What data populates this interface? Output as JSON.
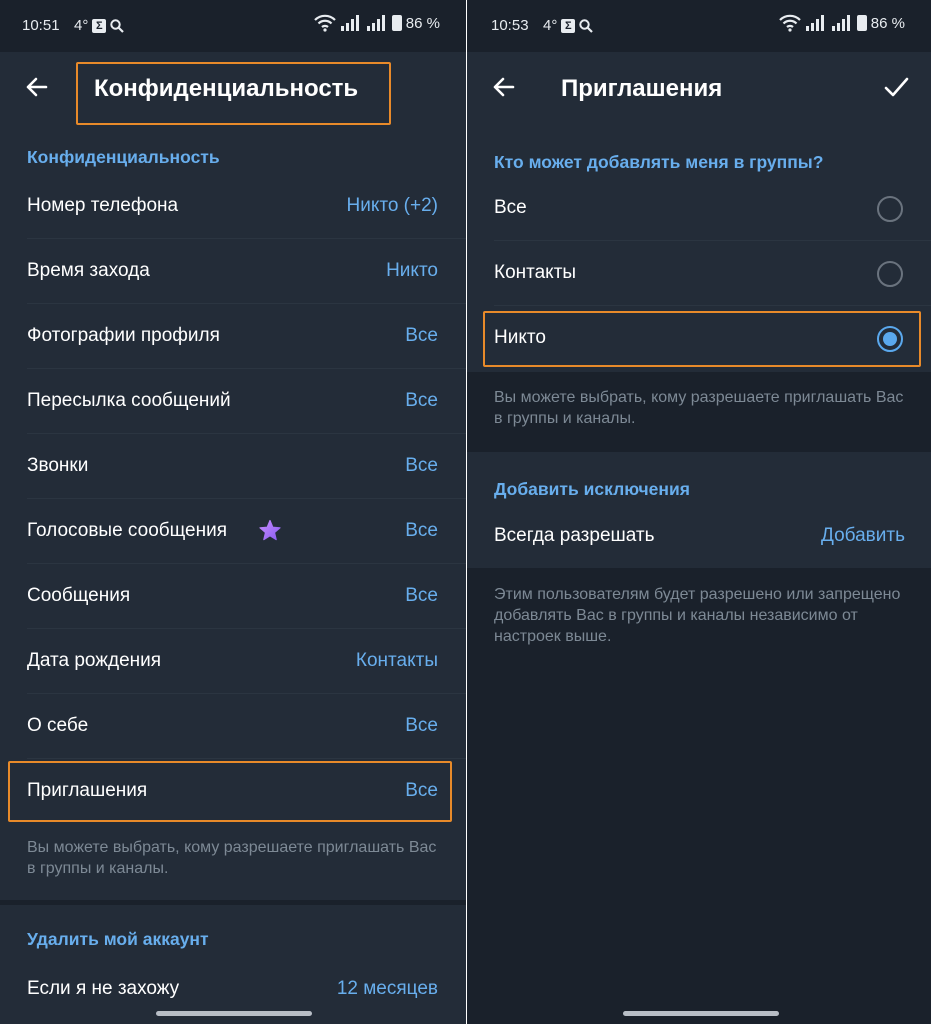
{
  "colors": {
    "background": "#1a212b",
    "section": "#232c38",
    "accent": "#68aeed",
    "note": "#7d8995",
    "highlight": "#e88a2a"
  },
  "left": {
    "status": {
      "time": "10:51",
      "temp": "4°",
      "battery": "86 %"
    },
    "title": "Конфиденциальность",
    "privacy_header": "Конфиденциальность",
    "items": [
      {
        "label": "Номер телефона",
        "value": "Никто (+2)"
      },
      {
        "label": "Время захода",
        "value": "Никто"
      },
      {
        "label": "Фотографии профиля",
        "value": "Все"
      },
      {
        "label": "Пересылка сообщений",
        "value": "Все"
      },
      {
        "label": "Звонки",
        "value": "Все"
      },
      {
        "label": "Голосовые сообщения",
        "value": "Все",
        "icon": "premium-star-icon"
      },
      {
        "label": "Сообщения",
        "value": "Все"
      },
      {
        "label": "Дата рождения",
        "value": "Контакты"
      },
      {
        "label": "О себе",
        "value": "Все"
      },
      {
        "label": "Приглашения",
        "value": "Все"
      }
    ],
    "note": "Вы можете выбрать, кому разрешаете приглашать Вас в группы и каналы.",
    "delete_header": "Удалить мой аккаунт",
    "delete_row": {
      "label": "Если я не захожу",
      "value": "12 месяцев"
    }
  },
  "right": {
    "status": {
      "time": "10:53",
      "temp": "4°",
      "battery": "86 %"
    },
    "title": "Приглашения",
    "who_header": "Кто может добавлять меня в группы?",
    "options": [
      {
        "label": "Все",
        "selected": false
      },
      {
        "label": "Контакты",
        "selected": false
      },
      {
        "label": "Никто",
        "selected": true
      }
    ],
    "note": "Вы можете выбрать, кому разрешаете приглашать Вас в группы и каналы.",
    "exceptions_header": "Добавить исключения",
    "always_allow": {
      "label": "Всегда разрешать",
      "action": "Добавить"
    },
    "exceptions_note": "Этим пользователям будет разрешено или запрещено добавлять Вас в группы и каналы независимо от настроек выше."
  }
}
